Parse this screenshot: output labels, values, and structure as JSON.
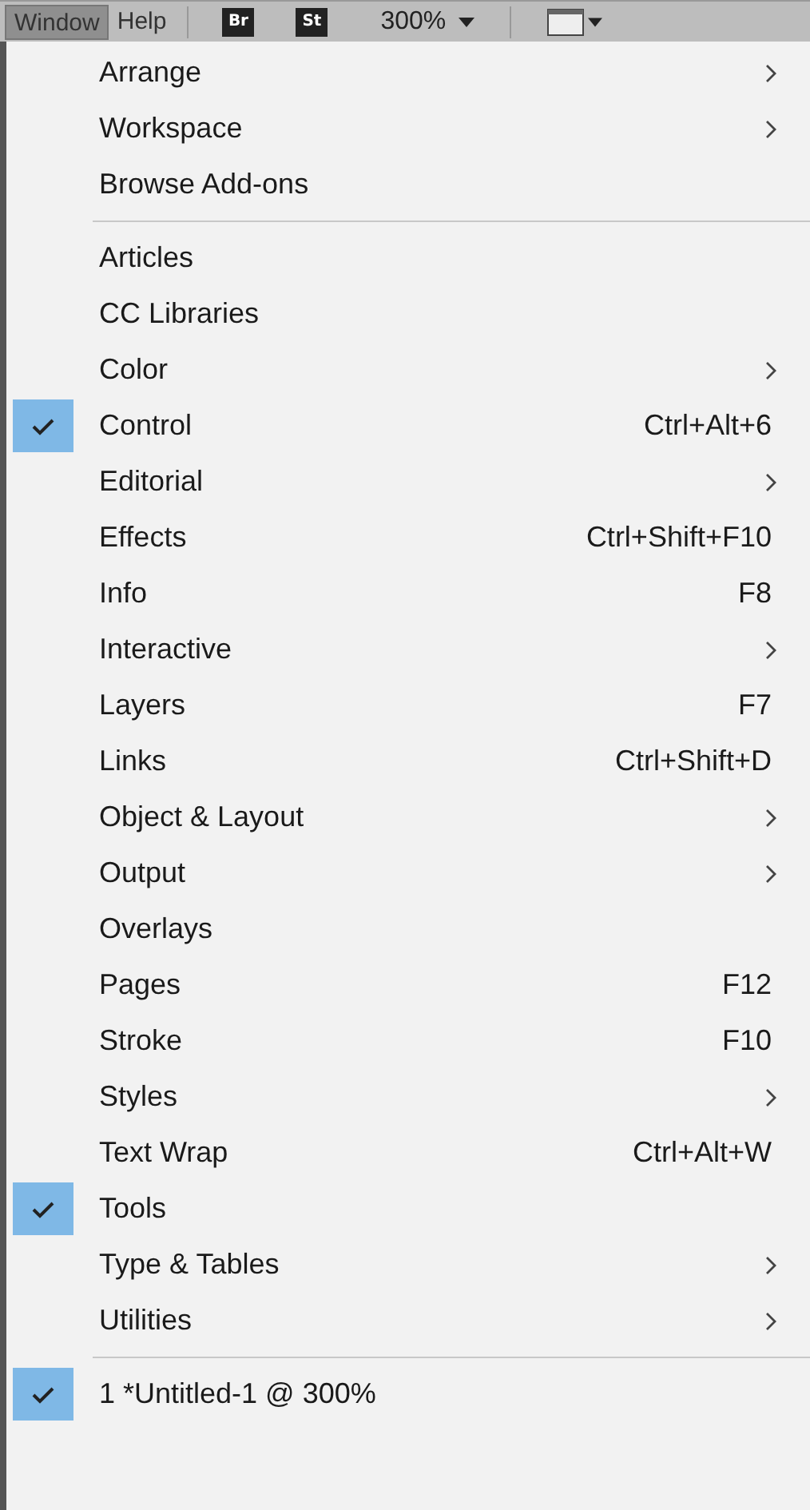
{
  "menu_bar": {
    "menus": [
      {
        "label": "Window",
        "selected": true
      },
      {
        "label": "Help",
        "selected": false
      }
    ],
    "app_buttons": [
      "Br",
      "St"
    ],
    "zoom": "300%"
  },
  "menu": {
    "groups": [
      [
        {
          "label": "Arrange",
          "submenu": true,
          "checked": false
        },
        {
          "label": "Workspace",
          "submenu": true,
          "checked": false
        },
        {
          "label": "Browse Add-ons",
          "submenu": false,
          "checked": false
        }
      ],
      [
        {
          "label": "Articles",
          "submenu": false,
          "checked": false
        },
        {
          "label": "CC Libraries",
          "submenu": false,
          "checked": false
        },
        {
          "label": "Color",
          "submenu": true,
          "checked": false
        },
        {
          "label": "Control",
          "shortcut": "Ctrl+Alt+6",
          "submenu": false,
          "checked": true
        },
        {
          "label": "Editorial",
          "submenu": true,
          "checked": false
        },
        {
          "label": "Effects",
          "shortcut": "Ctrl+Shift+F10",
          "submenu": false,
          "checked": false
        },
        {
          "label": "Info",
          "shortcut": "F8",
          "submenu": false,
          "checked": false
        },
        {
          "label": "Interactive",
          "submenu": true,
          "checked": false
        },
        {
          "label": "Layers",
          "shortcut": "F7",
          "submenu": false,
          "checked": false
        },
        {
          "label": "Links",
          "shortcut": "Ctrl+Shift+D",
          "submenu": false,
          "checked": false
        },
        {
          "label": "Object & Layout",
          "submenu": true,
          "checked": false
        },
        {
          "label": "Output",
          "submenu": true,
          "checked": false
        },
        {
          "label": "Overlays",
          "submenu": false,
          "checked": false
        },
        {
          "label": "Pages",
          "shortcut": "F12",
          "submenu": false,
          "checked": false
        },
        {
          "label": "Stroke",
          "shortcut": "F10",
          "submenu": false,
          "checked": false
        },
        {
          "label": "Styles",
          "submenu": true,
          "checked": false
        },
        {
          "label": "Text Wrap",
          "shortcut": "Ctrl+Alt+W",
          "submenu": false,
          "checked": false
        },
        {
          "label": "Tools",
          "submenu": false,
          "checked": true
        },
        {
          "label": "Type & Tables",
          "submenu": true,
          "checked": false
        },
        {
          "label": "Utilities",
          "submenu": true,
          "checked": false
        }
      ],
      [
        {
          "label": "1 *Untitled-1 @ 300%",
          "submenu": false,
          "checked": true
        }
      ]
    ]
  }
}
